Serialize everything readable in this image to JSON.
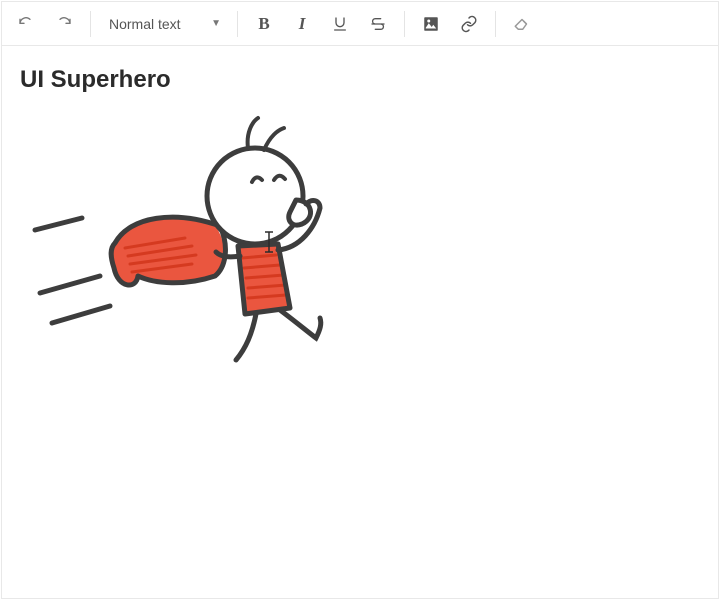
{
  "toolbar": {
    "undo": "undo",
    "redo": "redo",
    "text_style": "Normal text",
    "bold_label": "B",
    "italic_label": "I",
    "underline": "underline",
    "strike": "strike",
    "image": "image",
    "link": "link",
    "clear_format": "clear-format"
  },
  "document": {
    "title": "UI Superhero",
    "image_alt": "Hand-drawn superhero stick figure with red cape"
  }
}
